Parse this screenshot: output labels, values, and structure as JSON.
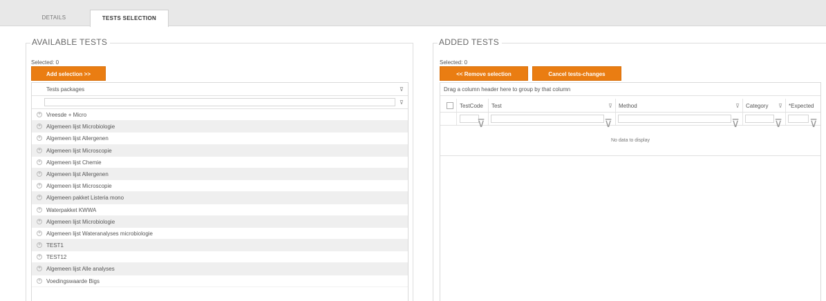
{
  "tabs": [
    {
      "label": "DETAILS"
    },
    {
      "label": "TESTS SELECTION"
    }
  ],
  "available": {
    "title": "AVAILABLE TESTS",
    "selected_text": "Selected: 0",
    "add_button": "Add selection >>",
    "column_header": "Tests packages",
    "packages": [
      "Vreesde + Micro",
      "Algemeen lijst Microbiologie",
      "Algemeen lijst Allergenen",
      "Algemeen lijst Microscopie",
      "Algemeen lijst Chemie",
      "Algemeen lijst Allergenen",
      "Algemeen lijst Microscopie",
      "Algemeen pakket Listeria mono",
      "Waterpakket KWWA",
      "Algemeen lijst Microbiologie",
      "Algemeen lijst Wateranalyses microbiologie",
      "TEST1",
      "TEST12",
      "Algemeen lijst Alle analyses",
      "Voedingswaarde Bigs"
    ]
  },
  "added": {
    "title": "ADDED TESTS",
    "selected_text": "Selected: 0",
    "remove_button": "<< Remove selection",
    "cancel_button": "Cancel tests-changes",
    "group_hint": "Drag a column header here to group by that column",
    "columns": {
      "testcode": "TestCode",
      "test": "Test",
      "method": "Method",
      "category": "Category",
      "expected": "*Expected"
    },
    "no_data": "No data to display"
  },
  "icons": {
    "filter": "filter-icon",
    "expand": "expand-icon"
  },
  "colors": {
    "accent": "#ea7d12",
    "tabbar": "#e8e8e8"
  }
}
